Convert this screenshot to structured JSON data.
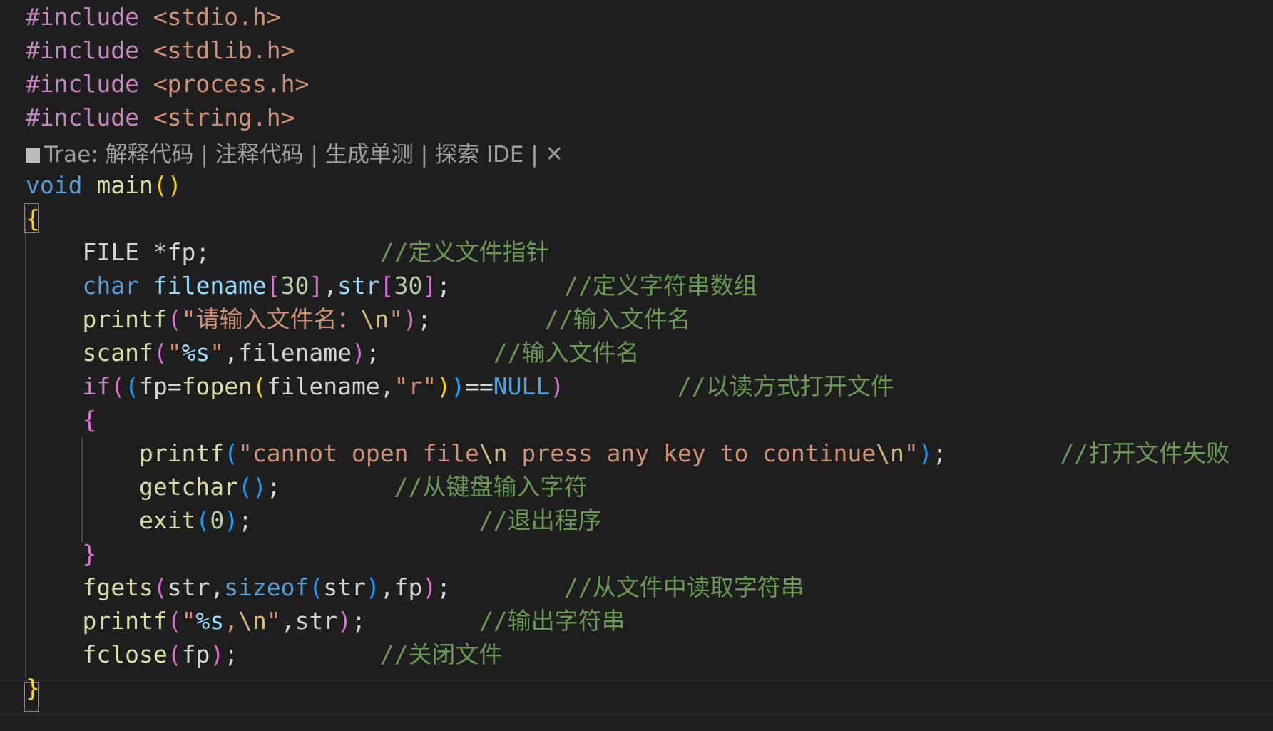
{
  "editor": {
    "colors": {
      "background": "#1e1e1e",
      "preprocessor": "#c586c0",
      "include_path": "#ce9178",
      "keyword": "#569cd6",
      "function": "#dcdcaa",
      "variable": "#9cdcfe",
      "string": "#ce9178",
      "escape": "#d7ba7d",
      "number": "#b5cea8",
      "comment": "#6a9955",
      "brace_gold": "#ffd700",
      "brace_purple": "#da70d6",
      "brace_blue": "#179fff",
      "plain": "#d4d4d4"
    },
    "codelens": {
      "icon": "square-icon",
      "prefix": "Trae: ",
      "links": [
        "解释代码",
        "注释代码",
        "生成单测",
        "探索 IDE"
      ],
      "separator": " | ",
      "close_icon": "close-x-icon"
    },
    "lines": [
      [
        {
          "t": "#include ",
          "c": "preprocessor"
        },
        {
          "t": "<stdio.h>",
          "c": "include_path"
        }
      ],
      [
        {
          "t": "#include ",
          "c": "preprocessor"
        },
        {
          "t": "<stdlib.h>",
          "c": "include_path"
        }
      ],
      [
        {
          "t": "#include ",
          "c": "preprocessor"
        },
        {
          "t": "<process.h>",
          "c": "include_path"
        }
      ],
      [
        {
          "t": "#include ",
          "c": "preprocessor"
        },
        {
          "t": "<string.h>",
          "c": "include_path"
        }
      ],
      [
        {
          "t": "void",
          "c": "keyword"
        },
        {
          "t": " ",
          "c": "plain"
        },
        {
          "t": "main",
          "c": "function"
        },
        {
          "t": "()",
          "c": "brace_gold"
        }
      ],
      [
        {
          "t": "{",
          "c": "brace_gold"
        }
      ],
      [
        {
          "t": "    FILE *fp;            ",
          "c": "plain"
        },
        {
          "t": "//定义文件指针",
          "c": "comment"
        }
      ],
      [
        {
          "t": "    ",
          "c": "plain"
        },
        {
          "t": "char",
          "c": "keyword"
        },
        {
          "t": " ",
          "c": "plain"
        },
        {
          "t": "filename",
          "c": "variable"
        },
        {
          "t": "[",
          "c": "brace_purple"
        },
        {
          "t": "30",
          "c": "number"
        },
        {
          "t": "]",
          "c": "brace_purple"
        },
        {
          "t": ",",
          "c": "plain"
        },
        {
          "t": "str",
          "c": "variable"
        },
        {
          "t": "[",
          "c": "brace_purple"
        },
        {
          "t": "30",
          "c": "number"
        },
        {
          "t": "]",
          "c": "brace_purple"
        },
        {
          "t": ";        ",
          "c": "plain"
        },
        {
          "t": "//定义字符串数组",
          "c": "comment"
        }
      ],
      [
        {
          "t": "    ",
          "c": "plain"
        },
        {
          "t": "printf",
          "c": "function"
        },
        {
          "t": "(",
          "c": "brace_purple"
        },
        {
          "t": "\"请输入文件名：",
          "c": "string"
        },
        {
          "t": "\\n",
          "c": "escape"
        },
        {
          "t": "\"",
          "c": "string"
        },
        {
          "t": ")",
          "c": "brace_purple"
        },
        {
          "t": ";        ",
          "c": "plain"
        },
        {
          "t": "//输入文件名",
          "c": "comment"
        }
      ],
      [
        {
          "t": "    ",
          "c": "plain"
        },
        {
          "t": "scanf",
          "c": "function"
        },
        {
          "t": "(",
          "c": "brace_purple"
        },
        {
          "t": "\"",
          "c": "string"
        },
        {
          "t": "%s",
          "c": "variable"
        },
        {
          "t": "\"",
          "c": "string"
        },
        {
          "t": ",filename",
          "c": "plain"
        },
        {
          "t": ")",
          "c": "brace_purple"
        },
        {
          "t": ";        ",
          "c": "plain"
        },
        {
          "t": "//输入文件名",
          "c": "comment"
        }
      ],
      [
        {
          "t": "    ",
          "c": "plain"
        },
        {
          "t": "if",
          "c": "preprocessor"
        },
        {
          "t": "(",
          "c": "brace_purple"
        },
        {
          "t": "(",
          "c": "brace_blue"
        },
        {
          "t": "fp=",
          "c": "plain"
        },
        {
          "t": "fopen",
          "c": "function"
        },
        {
          "t": "(",
          "c": "brace_gold"
        },
        {
          "t": "filename,",
          "c": "plain"
        },
        {
          "t": "\"r\"",
          "c": "string"
        },
        {
          "t": ")",
          "c": "brace_gold"
        },
        {
          "t": ")",
          "c": "brace_blue"
        },
        {
          "t": "==",
          "c": "plain"
        },
        {
          "t": "NULL",
          "c": "keyword"
        },
        {
          "t": ")",
          "c": "brace_purple"
        },
        {
          "t": "        ",
          "c": "plain"
        },
        {
          "t": "//以读方式打开文件",
          "c": "comment"
        }
      ],
      [
        {
          "t": "    ",
          "c": "plain"
        },
        {
          "t": "{",
          "c": "brace_purple"
        }
      ],
      [
        {
          "t": "        ",
          "c": "plain"
        },
        {
          "t": "printf",
          "c": "function"
        },
        {
          "t": "(",
          "c": "brace_blue"
        },
        {
          "t": "\"cannot open file",
          "c": "string"
        },
        {
          "t": "\\n",
          "c": "escape"
        },
        {
          "t": " press any key to continue",
          "c": "string"
        },
        {
          "t": "\\n",
          "c": "escape"
        },
        {
          "t": "\"",
          "c": "string"
        },
        {
          "t": ")",
          "c": "brace_blue"
        },
        {
          "t": ";        ",
          "c": "plain"
        },
        {
          "t": "//打开文件失败",
          "c": "comment"
        }
      ],
      [
        {
          "t": "        ",
          "c": "plain"
        },
        {
          "t": "getchar",
          "c": "function"
        },
        {
          "t": "()",
          "c": "brace_blue"
        },
        {
          "t": ";        ",
          "c": "plain"
        },
        {
          "t": "//从键盘输入字符",
          "c": "comment"
        }
      ],
      [
        {
          "t": "        ",
          "c": "plain"
        },
        {
          "t": "exit",
          "c": "function"
        },
        {
          "t": "(",
          "c": "brace_blue"
        },
        {
          "t": "0",
          "c": "number"
        },
        {
          "t": ")",
          "c": "brace_blue"
        },
        {
          "t": ";                ",
          "c": "plain"
        },
        {
          "t": "//退出程序",
          "c": "comment"
        }
      ],
      [
        {
          "t": "    ",
          "c": "plain"
        },
        {
          "t": "}",
          "c": "brace_purple"
        }
      ],
      [
        {
          "t": "    ",
          "c": "plain"
        },
        {
          "t": "fgets",
          "c": "function"
        },
        {
          "t": "(",
          "c": "brace_purple"
        },
        {
          "t": "str,",
          "c": "plain"
        },
        {
          "t": "sizeof",
          "c": "keyword"
        },
        {
          "t": "(",
          "c": "brace_blue"
        },
        {
          "t": "str",
          "c": "plain"
        },
        {
          "t": ")",
          "c": "brace_blue"
        },
        {
          "t": ",fp",
          "c": "plain"
        },
        {
          "t": ")",
          "c": "brace_purple"
        },
        {
          "t": ";        ",
          "c": "plain"
        },
        {
          "t": "//从文件中读取字符串",
          "c": "comment"
        }
      ],
      [
        {
          "t": "    ",
          "c": "plain"
        },
        {
          "t": "printf",
          "c": "function"
        },
        {
          "t": "(",
          "c": "brace_purple"
        },
        {
          "t": "\"",
          "c": "string"
        },
        {
          "t": "%s",
          "c": "variable"
        },
        {
          "t": ",",
          "c": "string"
        },
        {
          "t": "\\n",
          "c": "escape"
        },
        {
          "t": "\"",
          "c": "string"
        },
        {
          "t": ",str",
          "c": "plain"
        },
        {
          "t": ")",
          "c": "brace_purple"
        },
        {
          "t": ";        ",
          "c": "plain"
        },
        {
          "t": "//输出字符串",
          "c": "comment"
        }
      ],
      [
        {
          "t": "    ",
          "c": "plain"
        },
        {
          "t": "fclose",
          "c": "function"
        },
        {
          "t": "(",
          "c": "brace_purple"
        },
        {
          "t": "fp",
          "c": "plain"
        },
        {
          "t": ")",
          "c": "brace_purple"
        },
        {
          "t": ";          ",
          "c": "plain"
        },
        {
          "t": "//关闭文件",
          "c": "comment"
        }
      ],
      [
        {
          "t": "}",
          "c": "brace_gold"
        }
      ]
    ]
  }
}
